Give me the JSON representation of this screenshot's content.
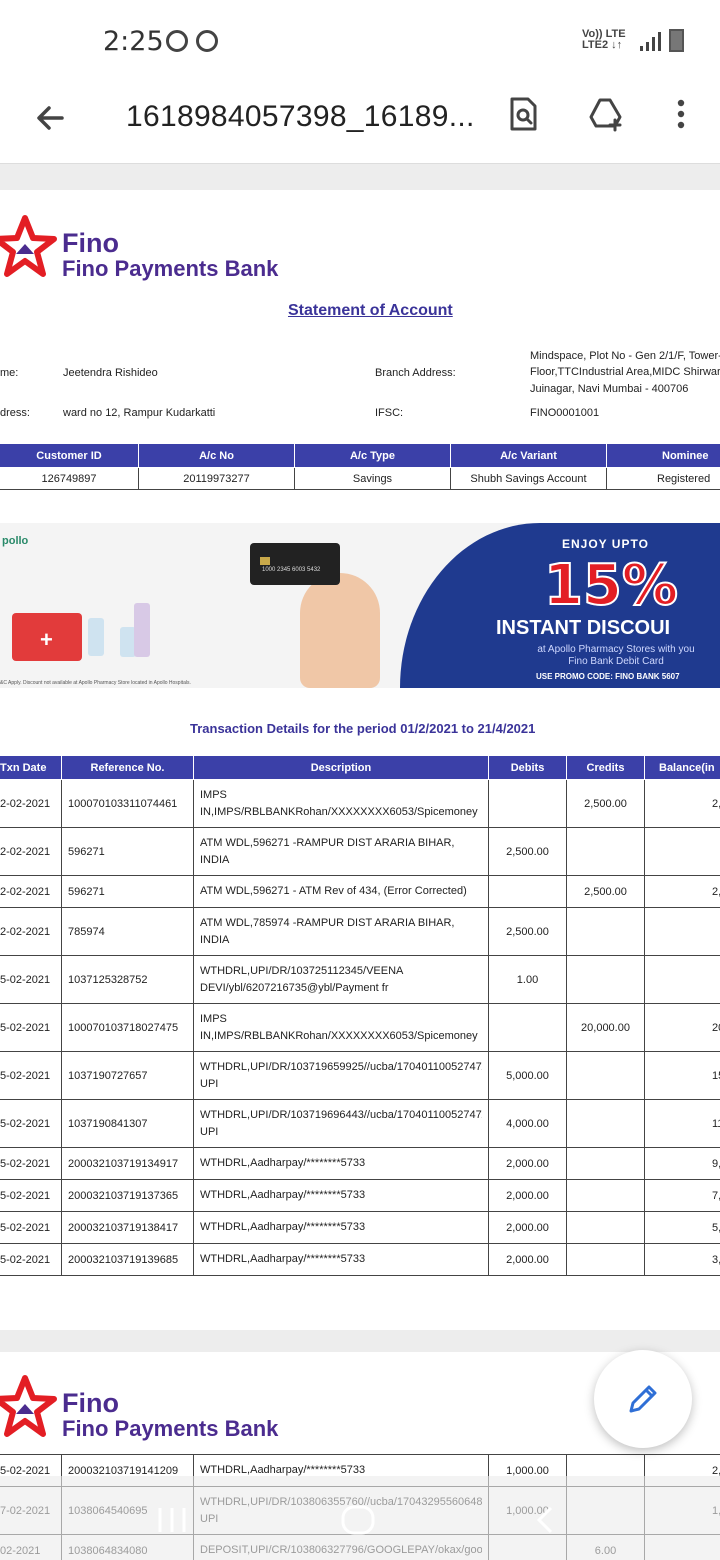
{
  "status": {
    "time": "2:25",
    "net_top": "Vo)) LTE",
    "net_bottom": "LTE2 ↓↑"
  },
  "toolbar": {
    "title": "1618984057398_16189..."
  },
  "logo": {
    "fino": "Fino",
    "bank": "Fino Payments Bank"
  },
  "statement_title": "Statement of Account",
  "info": {
    "name_label": "me:",
    "name": "Jeetendra Rishideo",
    "address_label": "dress:",
    "address": "ward no 12, Rampur Kudarkatti",
    "branch_label": "Branch Address:",
    "branch_lines": [
      "Mindspace, Plot No - Gen 2/1/F, Tower-",
      "Floor,TTCIndustrial Area,MIDC Shirwar",
      "Juinagar, Navi Mumbai - 400706"
    ],
    "ifsc_label": "IFSC:",
    "ifsc": "FINO0001001"
  },
  "account": {
    "headers": [
      "Customer ID",
      "A/c No",
      "A/c Type",
      "A/c Variant",
      "Nominee"
    ],
    "values": [
      "126749897",
      "20119973277",
      "Savings",
      "Shubh Savings Account",
      "Registered"
    ]
  },
  "banner": {
    "apollo": "pollo",
    "enjoy": "ENJOY UPTO",
    "pct": "15%",
    "instant": "INSTANT DISCOUI",
    "sub_1": "at Apollo Pharmacy Stores with you",
    "sub_2": "Fino Bank Debit Card",
    "promo": "USE PROMO CODE: FINO BANK 5607",
    "card_number": "1000 2345 6003 5432",
    "fine": "&C Apply. Discount not available at Apollo Pharmacy Store located in Apollo Hospitals."
  },
  "period_text": "Transaction Details for the period 01/2/2021 to 21/4/2021",
  "txn_headers": [
    "Txn Date",
    "Reference No.",
    "Description",
    "Debits",
    "Credits",
    "Balance(in"
  ],
  "transactions": [
    {
      "date": "2-02-2021",
      "ref": "100070103311074461",
      "desc": [
        "IMPS",
        "IN,IMPS/RBLBANKRohan/XXXXXXXX6053/Spicemoney"
      ],
      "debit": "",
      "credit": "2,500.00",
      "balance": "2,"
    },
    {
      "date": "2-02-2021",
      "ref": "596271",
      "desc": [
        "ATM WDL,596271 -RAMPUR DIST ARARIA BIHAR,",
        "INDIA"
      ],
      "debit": "2,500.00",
      "credit": "",
      "balance": ""
    },
    {
      "date": "2-02-2021",
      "ref": "596271",
      "desc": [
        "ATM WDL,596271 - ATM Rev of 434, (Error Corrected)"
      ],
      "debit": "",
      "credit": "2,500.00",
      "balance": "2,"
    },
    {
      "date": "2-02-2021",
      "ref": "785974",
      "desc": [
        "ATM WDL,785974 -RAMPUR DIST ARARIA BIHAR,",
        "INDIA"
      ],
      "debit": "2,500.00",
      "credit": "",
      "balance": ""
    },
    {
      "date": "5-02-2021",
      "ref": "1037125328752",
      "desc": [
        "WTHDRL,UPI/DR/103725112345/VEENA",
        "DEVI/ybl/6207216735@ybl/Payment fr"
      ],
      "debit": "1.00",
      "credit": "",
      "balance": ""
    },
    {
      "date": "5-02-2021",
      "ref": "100070103718027475",
      "desc": [
        "IMPS",
        "IN,IMPS/RBLBANKRohan/XXXXXXXX6053/Spicemoney"
      ],
      "debit": "",
      "credit": "20,000.00",
      "balance": "20,"
    },
    {
      "date": "5-02-2021",
      "ref": "1037190727657",
      "desc": [
        "WTHDRL,UPI/DR/103719659925//ucba/17040110052747/",
        "UPI"
      ],
      "debit": "5,000.00",
      "credit": "",
      "balance": "15,"
    },
    {
      "date": "5-02-2021",
      "ref": "1037190841307",
      "desc": [
        "WTHDRL,UPI/DR/103719696443//ucba/17040110052747/",
        "UPI"
      ],
      "debit": "4,000.00",
      "credit": "",
      "balance": "11,"
    },
    {
      "date": "5-02-2021",
      "ref": "200032103719134917",
      "desc": [
        "WTHDRL,Aadharpay/********5733"
      ],
      "debit": "2,000.00",
      "credit": "",
      "balance": "9,"
    },
    {
      "date": "5-02-2021",
      "ref": "200032103719137365",
      "desc": [
        "WTHDRL,Aadharpay/********5733"
      ],
      "debit": "2,000.00",
      "credit": "",
      "balance": "7,"
    },
    {
      "date": "5-02-2021",
      "ref": "200032103719138417",
      "desc": [
        "WTHDRL,Aadharpay/********5733"
      ],
      "debit": "2,000.00",
      "credit": "",
      "balance": "5,"
    },
    {
      "date": "5-02-2021",
      "ref": "200032103719139685",
      "desc": [
        "WTHDRL,Aadharpay/********5733"
      ],
      "debit": "2,000.00",
      "credit": "",
      "balance": "3,"
    }
  ],
  "transactions_page2": [
    {
      "date": "5-02-2021",
      "ref": "200032103719141209",
      "desc": [
        "WTHDRL,Aadharpay/********5733"
      ],
      "debit": "1,000.00",
      "credit": "",
      "balance": "2,"
    },
    {
      "date": "7-02-2021",
      "ref": "1038064540695",
      "desc": [
        "WTHDRL,UPI/DR/103806355760//ucba/17043295560648/",
        "UPI"
      ],
      "debit": "1,000.00",
      "credit": "",
      "balance": "1,"
    },
    {
      "date": "02-2021",
      "ref": "1038064834080",
      "desc": [
        "DEPOSIT,UPI/CR/103806327796/GOOGLEPAY/okax/goo"
      ],
      "debit": "",
      "credit": "6.00",
      "balance": ""
    }
  ],
  "colors": {
    "header_blue": "#3b40a8",
    "brand_purple": "#4b2c8f",
    "brand_red": "#e31e24"
  }
}
